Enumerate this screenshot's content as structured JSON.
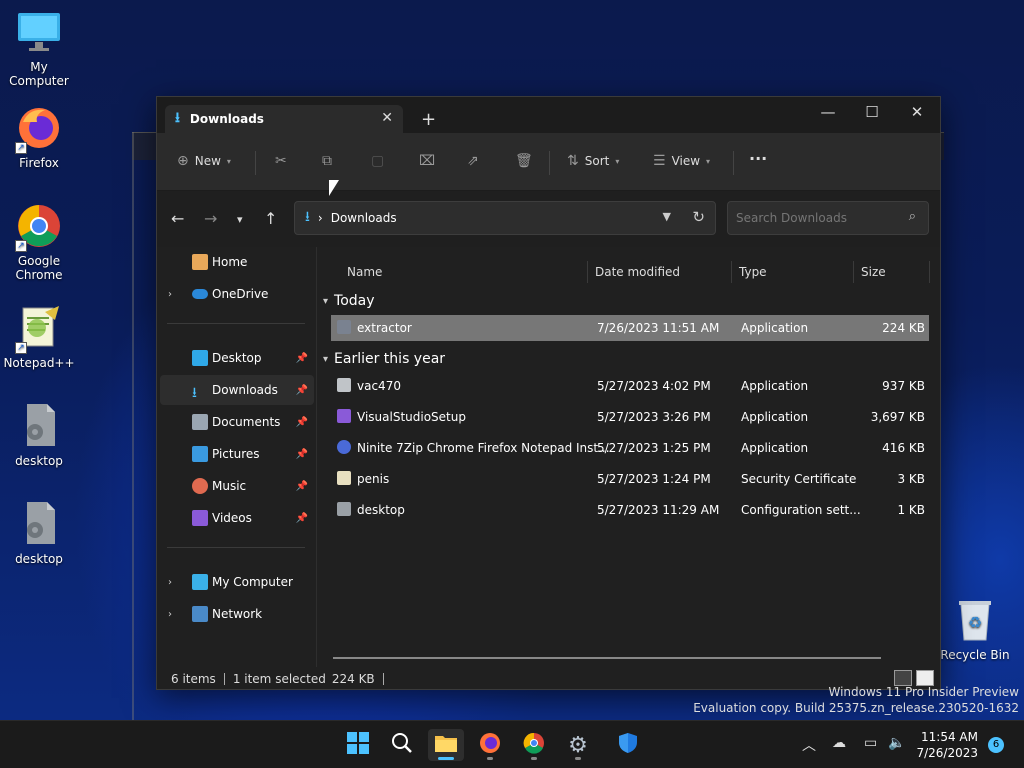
{
  "desktop": {
    "icons": [
      {
        "label": "My Computer",
        "icon": "monitor-icon"
      },
      {
        "label": "Firefox",
        "icon": "firefox-icon"
      },
      {
        "label": "Google Chrome",
        "icon": "chrome-icon"
      },
      {
        "label": "Notepad++",
        "icon": "notepadpp-icon"
      },
      {
        "label": "desktop",
        "icon": "config-file-icon"
      },
      {
        "label": "desktop",
        "icon": "config-file-icon"
      },
      {
        "label": "Recycle Bin",
        "icon": "recycle-bin-icon"
      }
    ]
  },
  "window": {
    "tab_title": "Downloads",
    "toolbar": {
      "new_label": "New",
      "sort_label": "Sort",
      "view_label": "View",
      "more_label": "···"
    },
    "address": {
      "path": "Downloads",
      "separator": "›"
    },
    "search": {
      "placeholder": "Search Downloads"
    },
    "sidebar": {
      "home": "Home",
      "onedrive": "OneDrive",
      "desktop": "Desktop",
      "downloads": "Downloads",
      "documents": "Documents",
      "pictures": "Pictures",
      "music": "Music",
      "videos": "Videos",
      "mycomputer": "My Computer",
      "network": "Network"
    },
    "columns": {
      "name": "Name",
      "date": "Date modified",
      "type": "Type",
      "size": "Size"
    },
    "groups": {
      "today": "Today",
      "earlier": "Earlier this year"
    },
    "files_today": [
      {
        "name": "extractor",
        "date": "7/26/2023 11:51 AM",
        "type": "Application",
        "size": "224 KB",
        "selected": true
      }
    ],
    "files_earlier": [
      {
        "name": "vac470",
        "date": "5/27/2023 4:02 PM",
        "type": "Application",
        "size": "937 KB"
      },
      {
        "name": "VisualStudioSetup",
        "date": "5/27/2023 3:26 PM",
        "type": "Application",
        "size": "3,697 KB"
      },
      {
        "name": "Ninite 7Zip Chrome Firefox Notepad Inst...",
        "date": "5/27/2023 1:25 PM",
        "type": "Application",
        "size": "416 KB"
      },
      {
        "name": "penis",
        "date": "5/27/2023 1:24 PM",
        "type": "Security Certificate",
        "size": "3 KB"
      },
      {
        "name": "desktop",
        "date": "5/27/2023 11:29 AM",
        "type": "Configuration sett...",
        "size": "1 KB"
      }
    ],
    "status": {
      "count": "6 items",
      "selection": "1 item selected",
      "selection_size": "224 KB"
    }
  },
  "watermark": {
    "line1": "Windows 11 Pro Insider Preview",
    "line2": "Evaluation copy. Build 25375.zn_release.230520-1632"
  },
  "taskbar": {
    "time": "11:54 AM",
    "date": "7/26/2023",
    "notifications": "6"
  },
  "colors": {
    "accent": "#4cc2ff",
    "window_bg": "#202020",
    "selected_row": "#777777"
  }
}
